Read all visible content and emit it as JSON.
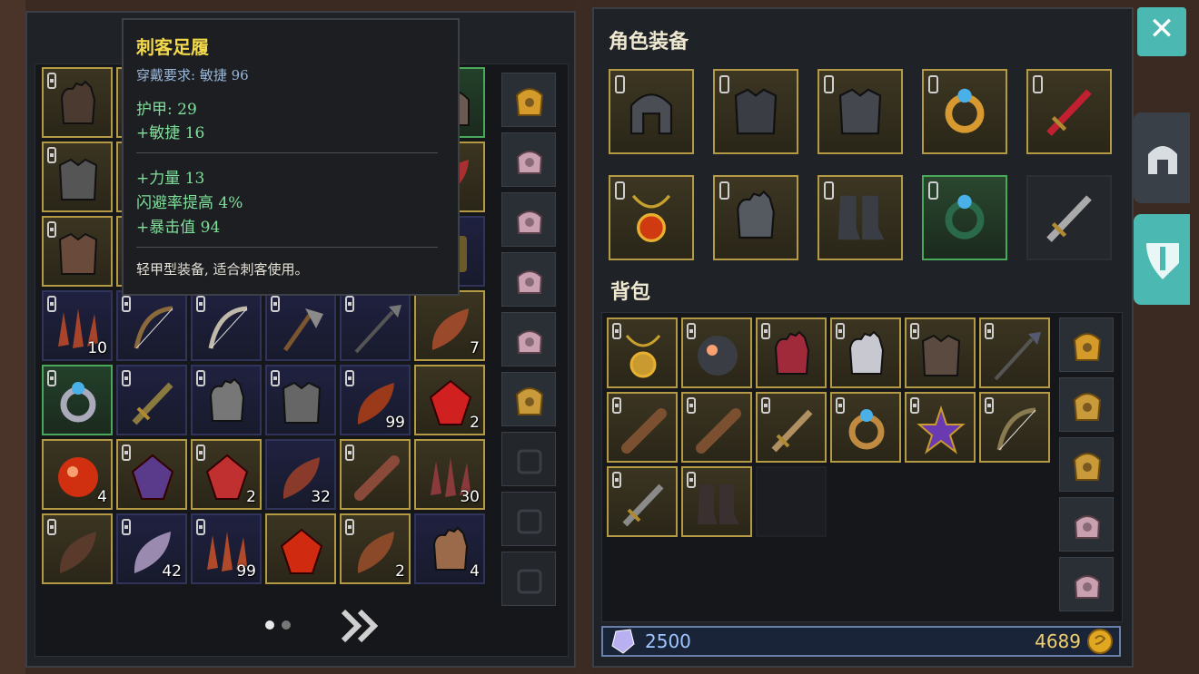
{
  "tooltip": {
    "name": "刺客足履",
    "requirement": "穿戴要求:  敏捷  96",
    "armor": "护甲:   29",
    "agility": "+敏捷  16",
    "strength": "+力量  13",
    "dodge": "闪避率提高    4%",
    "crit": "+暴击值  94",
    "description": "轻甲型装备, 适合刺客使用。"
  },
  "left_grid": {
    "quantities": {
      "r3c0": "10",
      "r3c5": "7",
      "r4c4": "99",
      "r4c5": "2",
      "r5c0": "4",
      "r5c2": "2",
      "r5c3": "32",
      "r5c5": "30",
      "r6c1": "42",
      "r6c2": "99",
      "r6c4": "2",
      "r6c5": "4"
    }
  },
  "equipment": {
    "title": "角色装备"
  },
  "backpack": {
    "title": "背包"
  },
  "currency": {
    "crystals": "2500",
    "gold": "4689"
  },
  "close_symbol": "✕",
  "colors": {
    "accent": "#4bb8b2",
    "gold_border": "#b59a46",
    "green_border": "#4aa85a",
    "tooltip_title": "#f2d84a",
    "tooltip_stat": "#7fe09a",
    "tooltip_req": "#9ab6d8"
  }
}
